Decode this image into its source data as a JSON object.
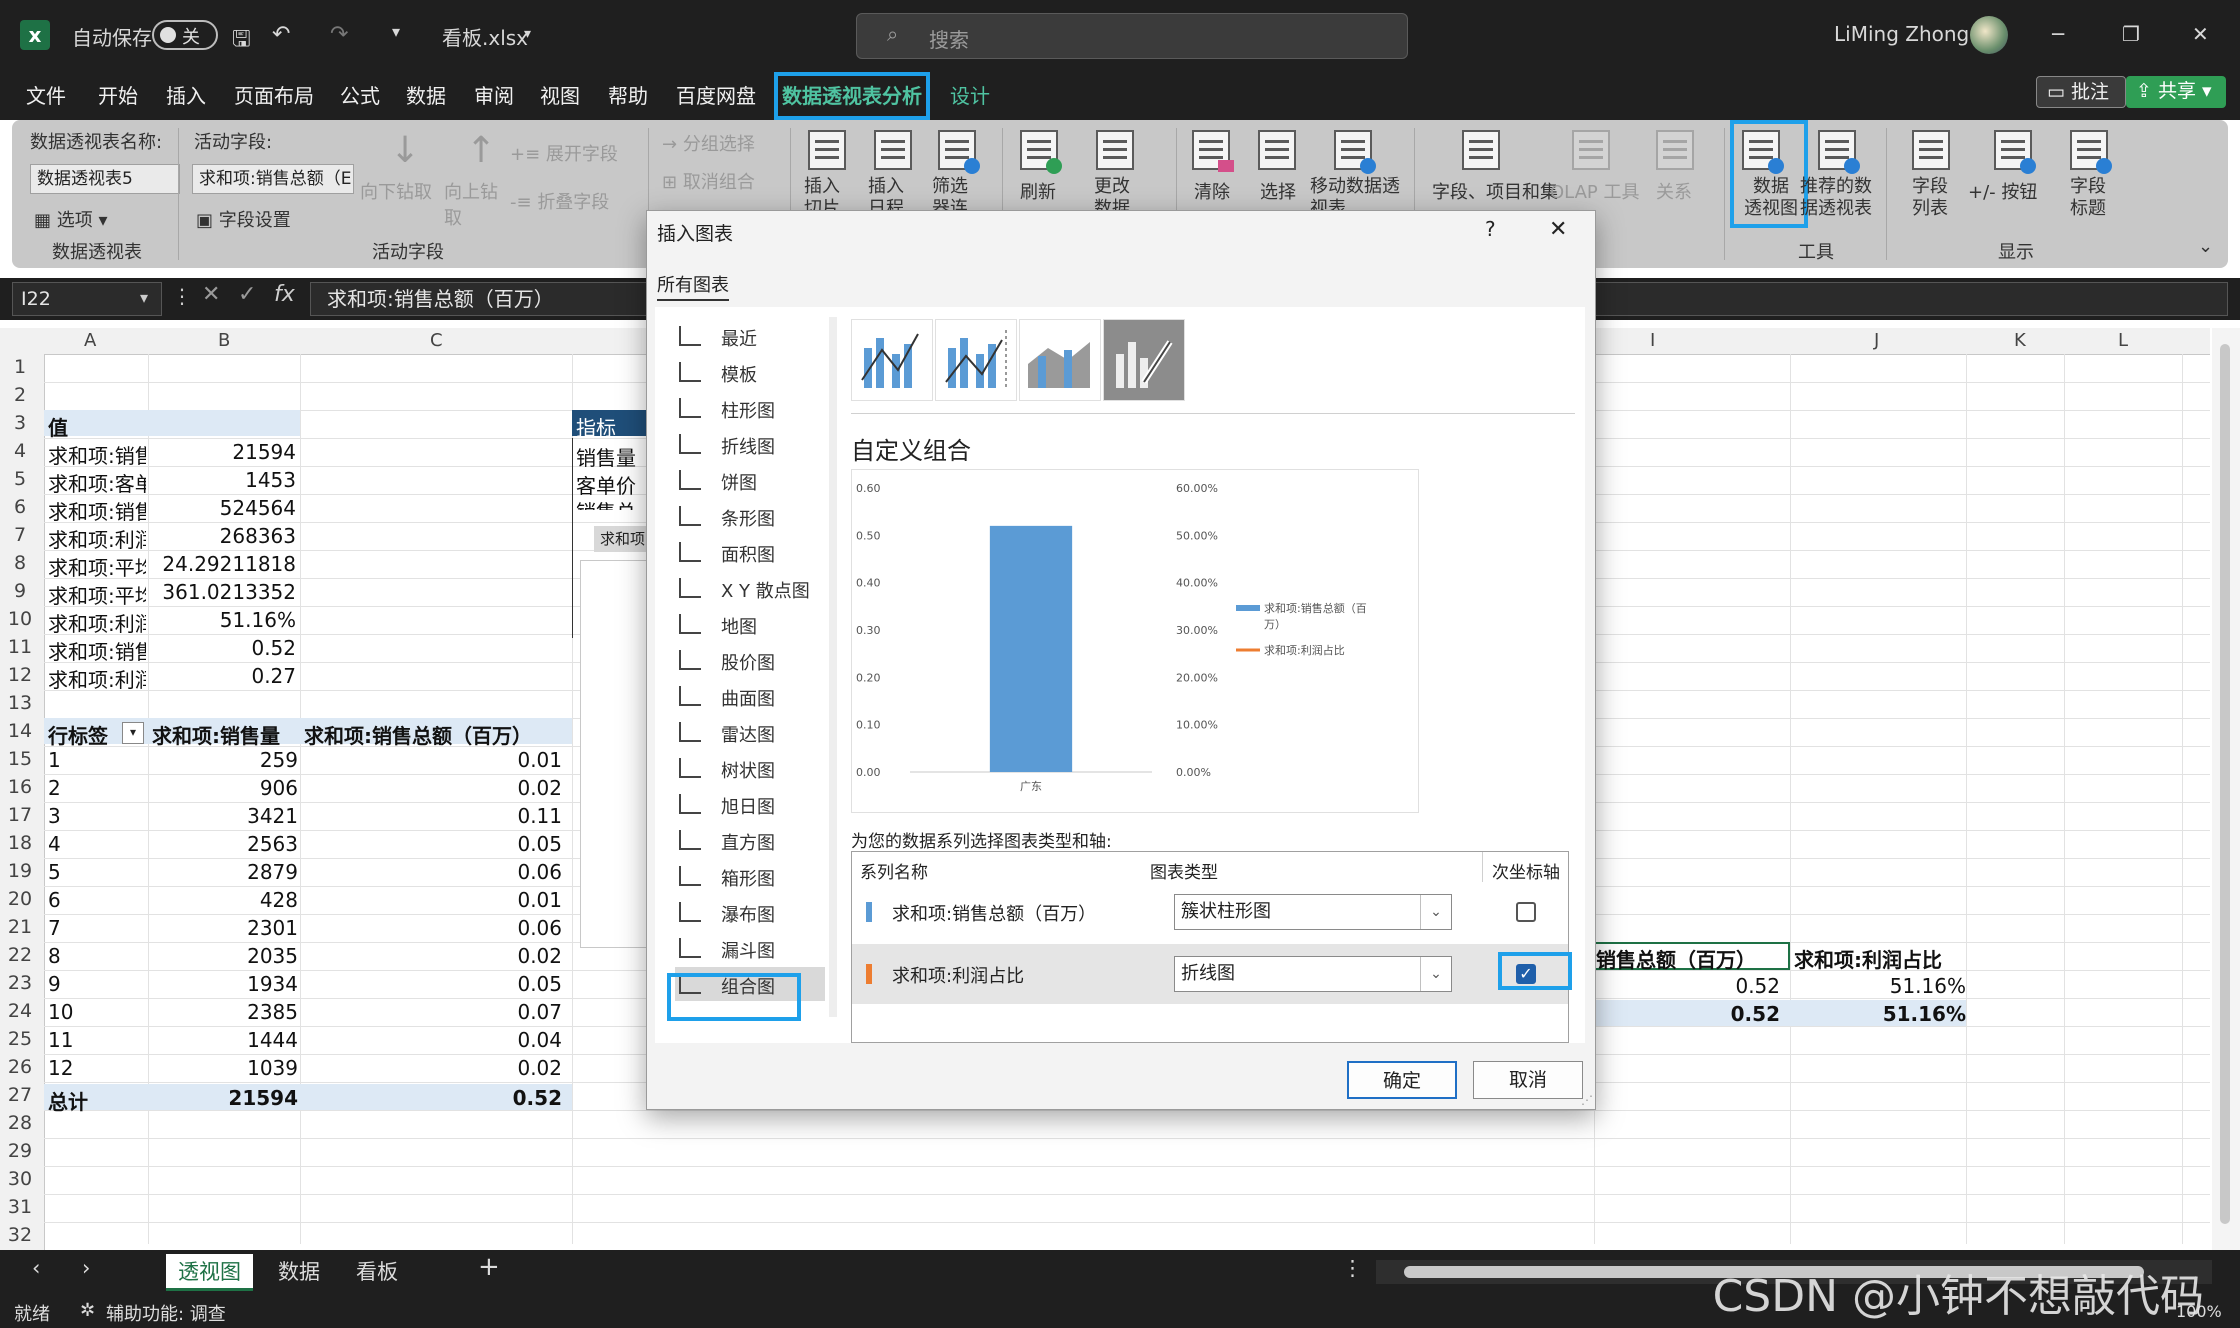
{
  "window": {
    "autosave_label": "自动保存",
    "autosave_state": "关",
    "file_name": "看板.xlsx",
    "search_placeholder": "搜索",
    "user_name": "LiMing Zhong",
    "controls": {
      "minimize": "─",
      "restore": "❐",
      "close": "✕"
    }
  },
  "menu": {
    "items": [
      "文件",
      "开始",
      "插入",
      "页面布局",
      "公式",
      "数据",
      "审阅",
      "视图",
      "帮助",
      "百度网盘",
      "数据透视表分析",
      "设计"
    ],
    "active_index": 10,
    "comments_label": "批注",
    "share_label": "共享"
  },
  "ribbon": {
    "pivot_name_label": "数据透视表名称:",
    "pivot_name_value": "数据透视表5",
    "options_label": "选项",
    "group_pivot": "数据透视表",
    "active_field_label": "活动字段:",
    "active_field_value": "求和项:销售总额（E",
    "field_settings": "字段设置",
    "drill_down": "向下钻取",
    "drill_up": "向上钻取",
    "expand_field": "展开字段",
    "collapse_field": "折叠字段",
    "group_active_field": "活动字段",
    "group_selection": "分组选择",
    "ungroup": "取消组合",
    "insert_slicer": "插入切片器",
    "insert_timeline": "插入日程表",
    "filter_connections": "筛选器连接",
    "refresh": "刷新",
    "change_source": "更改数据源",
    "clear": "清除",
    "select": "选择",
    "move_pivot": "移动数据透视表",
    "fields_items": "字段、项目和集",
    "olap_tools": "OLAP 工具",
    "relationships": "关系",
    "pivot_chart": "数据透视图",
    "recommended_pivot_1": "推荐的数",
    "recommended_pivot_2": "据透视表",
    "group_tools": "工具",
    "field_list_1": "字段",
    "field_list_2": "列表",
    "plus_minus_buttons": "+/- 按钮",
    "field_headers_1": "字段",
    "field_headers_2": "标题",
    "group_show": "显示",
    "pivot_chart_line1": "数据",
    "pivot_chart_line2": "透视图"
  },
  "formula_bar": {
    "name_box": "I22",
    "formula": "求和项:销售总额（百万）"
  },
  "columns_left": [
    "A",
    "B",
    "C"
  ],
  "columns_right": [
    "I",
    "J",
    "K",
    "L"
  ],
  "row_numbers": [
    "1",
    "2",
    "3",
    "4",
    "5",
    "6",
    "7",
    "8",
    "9",
    "10",
    "11",
    "12",
    "13",
    "14",
    "15",
    "16",
    "17",
    "18",
    "19",
    "20",
    "21",
    "22",
    "23",
    "24",
    "25",
    "26",
    "27",
    "28",
    "29",
    "30",
    "31",
    "32"
  ],
  "values_table": {
    "header": "值",
    "rows": [
      {
        "label": "求和项:销售",
        "value": "21594"
      },
      {
        "label": "求和项:客单",
        "value": "1453"
      },
      {
        "label": "求和项:销售",
        "value": "524564"
      },
      {
        "label": "求和项:利润",
        "value": "268363"
      },
      {
        "label": "求和项:平均",
        "value": "24.29211818"
      },
      {
        "label": "求和项:平均",
        "value": "361.0213352"
      },
      {
        "label": "求和项:利润",
        "value": "51.16%"
      },
      {
        "label": "求和项:销售",
        "value": "0.52"
      },
      {
        "label": "求和项:利润",
        "value": "0.27"
      }
    ]
  },
  "pivot_table": {
    "headers": [
      "行标签",
      "求和项:销售量",
      "求和项:销售总额（百万）"
    ],
    "rows": [
      [
        "1",
        "259",
        "0.01"
      ],
      [
        "2",
        "906",
        "0.02"
      ],
      [
        "3",
        "3421",
        "0.11"
      ],
      [
        "4",
        "2563",
        "0.05"
      ],
      [
        "5",
        "2879",
        "0.06"
      ],
      [
        "6",
        "428",
        "0.01"
      ],
      [
        "7",
        "2301",
        "0.06"
      ],
      [
        "8",
        "2035",
        "0.02"
      ],
      [
        "9",
        "1934",
        "0.05"
      ],
      [
        "10",
        "2385",
        "0.07"
      ],
      [
        "11",
        "1444",
        "0.04"
      ],
      [
        "12",
        "1039",
        "0.02"
      ]
    ],
    "total": [
      "总计",
      "21594",
      "0.52"
    ]
  },
  "indicator_table": {
    "header": "指标",
    "rows": [
      "销售量",
      "客单价",
      "销售总"
    ],
    "chip": "求和项"
  },
  "right_table": {
    "headers": [
      "销售总额（百万）",
      "求和项:利润占比"
    ],
    "row": [
      "0.52",
      "51.16%"
    ],
    "total": [
      "0.52",
      "51.16%"
    ]
  },
  "sheets": {
    "tabs": [
      "透视图",
      "数据",
      "看板"
    ],
    "active_index": 0,
    "add_label": "+"
  },
  "status": {
    "ready": "就绪",
    "accessibility": "辅助功能: 调查",
    "zoom": "100%",
    "watermark": "CSDN @小钟不想敲代码"
  },
  "dialog": {
    "title": "插入图表",
    "help": "?",
    "close": "✕",
    "tab": "所有图表",
    "chart_types": [
      "最近",
      "模板",
      "柱形图",
      "折线图",
      "饼图",
      "条形图",
      "面积图",
      "X Y 散点图",
      "地图",
      "股价图",
      "曲面图",
      "雷达图",
      "树状图",
      "旭日图",
      "直方图",
      "箱形图",
      "瀑布图",
      "漏斗图",
      "组合图"
    ],
    "selected_type_index": 18,
    "subtype_title": "自定义组合",
    "series_prompt": "为您的数据系列选择图表类型和轴:",
    "col_series": "系列名称",
    "col_type": "图表类型",
    "col_axis": "次坐标轴",
    "series": [
      {
        "name": "求和项:销售总额（百万）",
        "type": "簇状柱形图",
        "secondary_axis": false,
        "color": "#5b9bd5"
      },
      {
        "name": "求和项:利润占比",
        "type": "折线图",
        "secondary_axis": true,
        "color": "#ed7d31"
      }
    ],
    "ok": "确定",
    "cancel": "取消"
  },
  "chart_data": {
    "type": "bar",
    "categories": [
      "广东"
    ],
    "series": [
      {
        "name": "求和项:销售总额（百万）",
        "values": [
          0.52
        ],
        "axis": "primary",
        "kind": "bar"
      },
      {
        "name": "求和项:利润占比",
        "values": [
          0.5116
        ],
        "axis": "secondary",
        "kind": "line"
      }
    ],
    "y_ticks": [
      "0.00",
      "0.10",
      "0.20",
      "0.30",
      "0.40",
      "0.50",
      "0.60"
    ],
    "y2_ticks": [
      "0.00%",
      "10.00%",
      "20.00%",
      "30.00%",
      "40.00%",
      "50.00%",
      "60.00%"
    ],
    "ylim": [
      0,
      0.6
    ],
    "y2lim": [
      0,
      0.6
    ],
    "legend": [
      "求和项:销售总额（百",
      "万）",
      "求和项:利润占比"
    ],
    "legend_position": "right"
  }
}
